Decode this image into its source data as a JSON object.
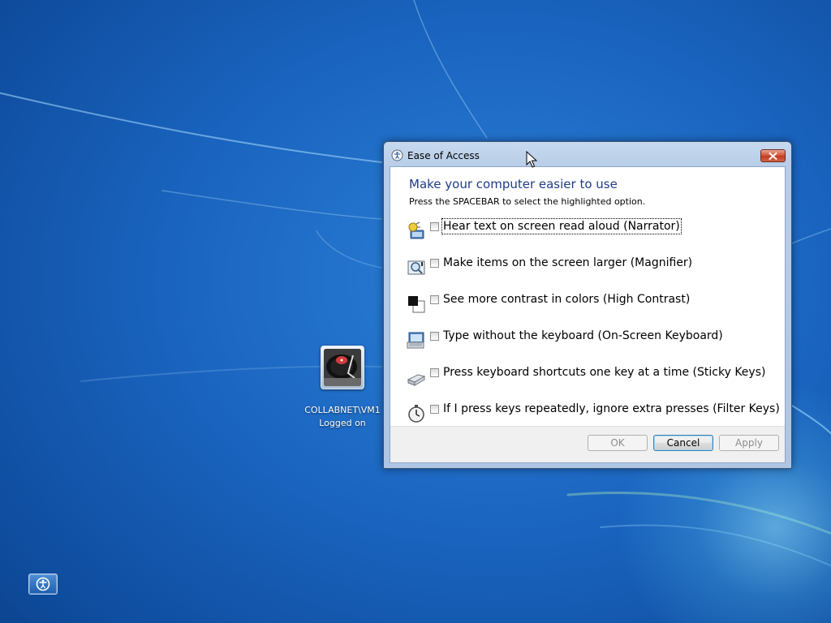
{
  "user": {
    "name": "COLLABNET\\VM1",
    "status": "Logged on"
  },
  "dialog": {
    "title": "Ease of Access",
    "heading": "Make your computer easier to use",
    "instruction": "Press the SPACEBAR to select the highlighted option.",
    "options": [
      {
        "label": "Hear text on screen read aloud (Narrator)",
        "icon": "narrator-icon",
        "checked": false
      },
      {
        "label": "Make items on the screen larger (Magnifier)",
        "icon": "magnifier-icon",
        "checked": false
      },
      {
        "label": "See more contrast in colors (High Contrast)",
        "icon": "high-contrast-icon",
        "checked": false
      },
      {
        "label": "Type without the keyboard (On-Screen Keyboard)",
        "icon": "on-screen-keyboard-icon",
        "checked": false
      },
      {
        "label": "Press keyboard shortcuts one key at a time (Sticky Keys)",
        "icon": "sticky-keys-icon",
        "checked": false
      },
      {
        "label": "If I press keys repeatedly, ignore extra presses (Filter Keys)",
        "icon": "filter-keys-icon",
        "checked": false
      }
    ],
    "buttons": {
      "ok": "OK",
      "cancel": "Cancel",
      "apply": "Apply"
    }
  },
  "colors": {
    "heading": "#1e3c87",
    "desktop": "#1a64bf"
  }
}
